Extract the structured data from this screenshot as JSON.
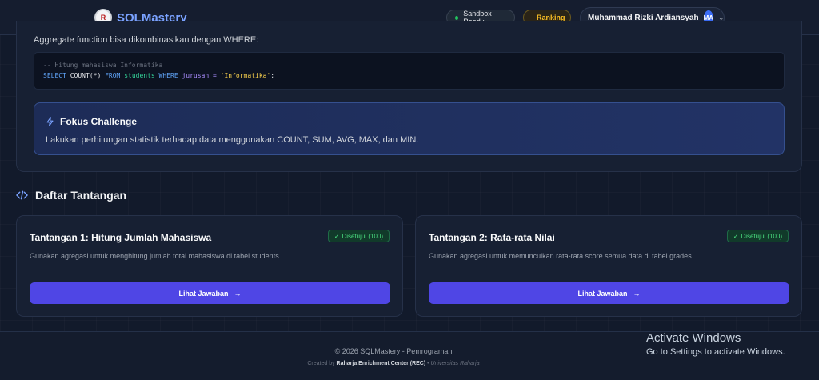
{
  "nav": {
    "brand": "SQLMastery",
    "logo_mark": "R",
    "sandbox_label": "Sandbox Ready",
    "ranking_label": "Ranking",
    "user_name": "Muhammad Rizki Ardiansyah",
    "avatar_initials": "MA"
  },
  "lesson": {
    "aggregate_text": "Aggregate function bisa dikombinasikan dengan WHERE:",
    "code": {
      "comment": "-- Hitung mahasiswa Informatika",
      "kw_select": "SELECT",
      "fn_count": "COUNT(*)",
      "kw_from": "FROM",
      "table": "students",
      "kw_where": "WHERE",
      "condition": "jurusan =",
      "value": "'Informatika'",
      "end": ";"
    },
    "focus": {
      "title": "Fokus Challenge",
      "description": "Lakukan perhitungan statistik terhadap data menggunakan COUNT, SUM, AVG, MAX, dan MIN."
    }
  },
  "challenges_section": {
    "title": "Daftar Tantangan",
    "items": [
      {
        "title": "Tantangan 1: Hitung Jumlah Mahasiswa",
        "badge": "Disetujui (100)",
        "description": "Gunakan agregasi untuk menghitung jumlah total mahasiswa di tabel students.",
        "button": "Lihat Jawaban"
      },
      {
        "title": "Tantangan 2: Rata-rata Nilai",
        "badge": "Disetujui (100)",
        "description": "Gunakan agregasi untuk memunculkan rata-rata score semua data di tabel grades.",
        "button": "Lihat Jawaban"
      }
    ]
  },
  "footer": {
    "copyright": "© 2026 SQLMastery - Pemrograman",
    "created_prefix": "Created by",
    "created_org": "Raharja Enrichment Center (REC)",
    "created_sep": "•",
    "created_uni": "Universitas Raharja"
  },
  "watermark": {
    "title": "Activate Windows",
    "subtitle": "Go to Settings to activate Windows."
  },
  "colors": {
    "accent": "#4f46e5",
    "brand": "#7aa2ff",
    "success": "#4ade80",
    "ranking": "#fbbf24"
  }
}
